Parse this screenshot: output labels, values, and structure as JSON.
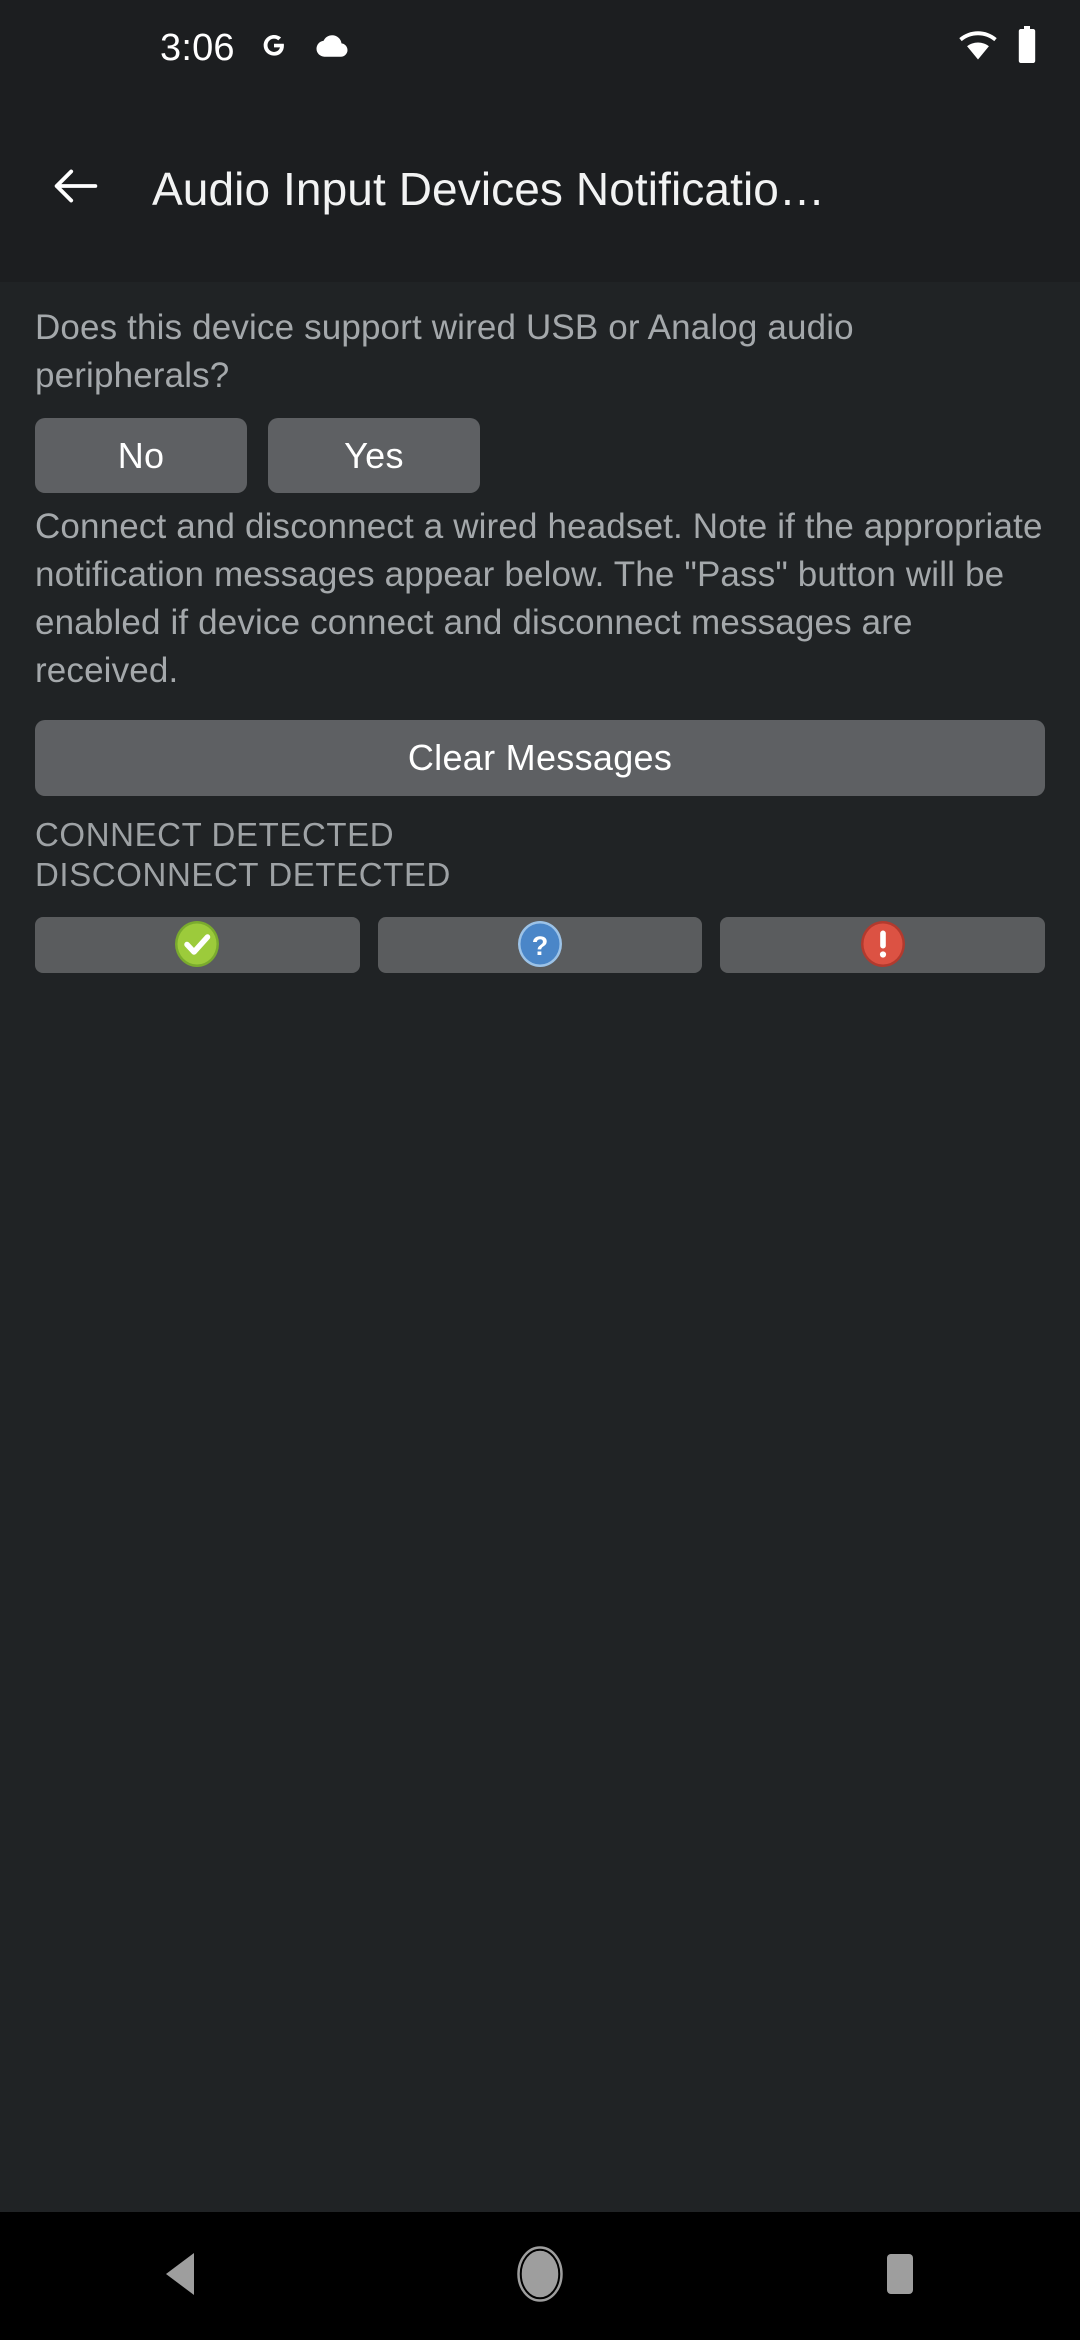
{
  "status_bar": {
    "clock": "3:06",
    "left_icons": [
      "google-g-icon",
      "cloud-icon"
    ],
    "right_icons": [
      "wifi-icon",
      "battery-icon"
    ]
  },
  "app_bar": {
    "back_icon": "arrow-left-icon",
    "title": "Audio Input Devices Notificatio…"
  },
  "main": {
    "question_text": "Does this device support wired USB or Analog audio peripherals?",
    "yes_no": {
      "no_label": "No",
      "yes_label": "Yes"
    },
    "instruction_text": "Connect and disconnect a wired headset. Note if the appropriate notification messages appear below. The \"Pass\" button will be enabled if device connect and disconnect messages are received.",
    "clear_messages_label": "Clear Messages",
    "messages": [
      "CONNECT DETECTED",
      "DISCONNECT DETECTED"
    ],
    "verdict_buttons": [
      {
        "name": "pass-button",
        "icon": "check-circle-icon",
        "color": "#8CC63F"
      },
      {
        "name": "info-button",
        "icon": "question-circle-icon",
        "color": "#4A86C8"
      },
      {
        "name": "fail-button",
        "icon": "exclamation-circle-icon",
        "color": "#D9483B"
      }
    ]
  },
  "nav_bar": {
    "back_icon": "triangle-back-icon",
    "home_icon": "circle-home-icon",
    "recents_icon": "square-recents-icon"
  },
  "colors": {
    "screen_background": "#1c1e20",
    "content_background": "#202325",
    "button_fill": "#5e6063",
    "primary_text": "#f2f3f3",
    "secondary_text": "#a4a8ab",
    "nav_bar_background": "#000000",
    "nav_icon": "#9e9e9e"
  }
}
